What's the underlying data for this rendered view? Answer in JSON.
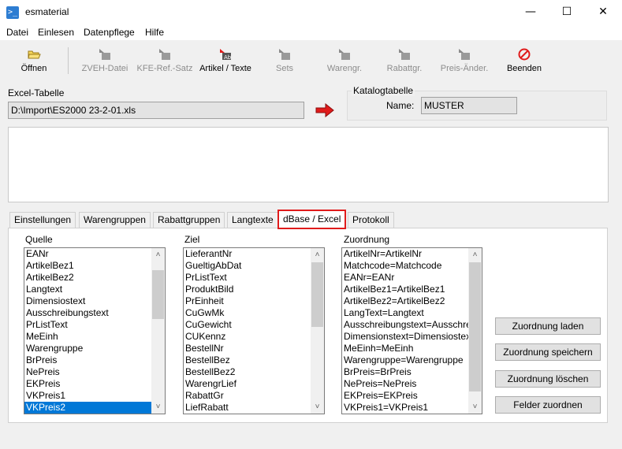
{
  "window": {
    "title": "esmaterial",
    "minimize": "—",
    "maximize": "☐",
    "close": "✕"
  },
  "menu": [
    "Datei",
    "Einlesen",
    "Datenpflege",
    "Hilfe"
  ],
  "toolbar": {
    "open": "Öffnen",
    "zveh": "ZVEH-Datei",
    "kfe": "KFE-Ref.-Satz",
    "artikel": "Artikel / Texte",
    "sets": "Sets",
    "warengr": "Warengr.",
    "rabattgr": "Rabattgr.",
    "preis": "Preis-Änder.",
    "beenden": "Beenden"
  },
  "excel": {
    "label": "Excel-Tabelle",
    "path": "D:\\Import\\ES2000 23-2-01.xls"
  },
  "katalog": {
    "label": "Katalogtabelle",
    "name_label": "Name:",
    "name_value": "MUSTER"
  },
  "tabs": [
    "Einstellungen",
    "Warengruppen",
    "Rabattgruppen",
    "Langtexte",
    "dBase / Excel",
    "Protokoll"
  ],
  "quelle": {
    "label": "Quelle",
    "items": [
      "EANr",
      "ArtikelBez1",
      "ArtikelBez2",
      "Langtext",
      "Dimensiostext",
      "Ausschreibungstext",
      "PrListText",
      "MeEinh",
      "Warengruppe",
      "BrPreis",
      "NePreis",
      "EKPreis",
      "VKPreis1",
      "VKPreis2"
    ],
    "selected": "VKPreis2"
  },
  "ziel": {
    "label": "Ziel",
    "items": [
      "LieferantNr",
      "GueltigAbDat",
      "PrListText",
      "ProduktBild",
      "PrEinheit",
      "CuGwMk",
      "CuGewicht",
      "CUKennz",
      "BestellNr",
      "BestellBez",
      "BestellBez2",
      "WarengrLief",
      "RabattGr",
      "LiefRabatt"
    ]
  },
  "zuordnung": {
    "label": "Zuordnung",
    "items": [
      "ArtikelNr=ArtikelNr",
      "Matchcode=Matchcode",
      "EANr=EANr",
      "ArtikelBez1=ArtikelBez1",
      "ArtikelBez2=ArtikelBez2",
      "LangText=Langtext",
      "Ausschreibungstext=Ausschreibungstext",
      "Dimensionstext=Dimensiostext",
      "MeEinh=MeEinh",
      "Warengruppe=Warengruppe",
      "BrPreis=BrPreis",
      "NePreis=NePreis",
      "EKPreis=EKPreis",
      "VKPreis1=VKPreis1"
    ]
  },
  "buttons": {
    "laden": "Zuordnung laden",
    "speichern": "Zuordnung speichern",
    "loeschen": "Zuordnung löschen",
    "felder": "Felder zuordnen"
  },
  "colors": {
    "selection": "#0078d7",
    "active_tab_border": "#e01b1b",
    "arrow": "#e01b1b"
  }
}
